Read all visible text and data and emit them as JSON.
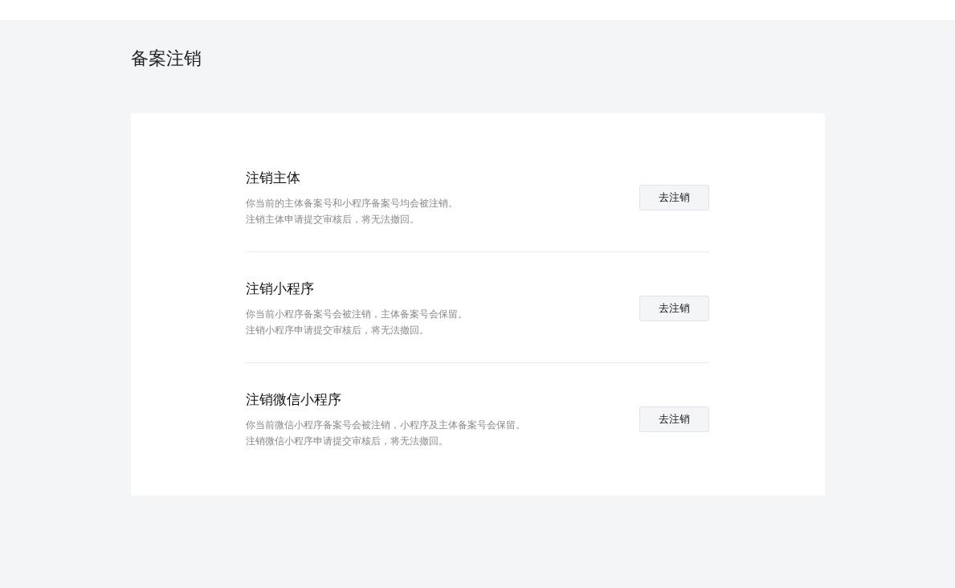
{
  "page_title": "备案注销",
  "items": [
    {
      "title": "注销主体",
      "description": [
        "你当前的主体备案号和小程序备案号均会被注销。",
        "注销主体申请提交审核后，将无法撤回。"
      ],
      "button": "去注销"
    },
    {
      "title": "注销小程序",
      "description": [
        "你当前小程序备案号会被注销，主体备案号会保留。",
        "注销小程序申请提交审核后，将无法撤回。"
      ],
      "button": "去注销"
    },
    {
      "title": "注销微信小程序",
      "description": [
        "你当前微信小程序备案号会被注销，小程序及主体备案号会保留。",
        "注销微信小程序申请提交审核后，将无法撤回。"
      ],
      "button": "去注销"
    }
  ]
}
